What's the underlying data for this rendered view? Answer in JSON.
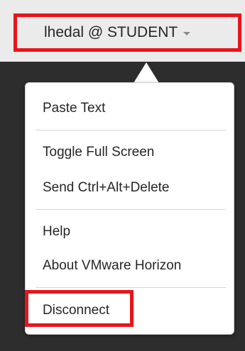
{
  "header": {
    "user_label": "lhedal @ STUDENT",
    "dropdown_icon": "caret-down-icon"
  },
  "menu": {
    "paste_text": "Paste Text",
    "toggle_full_screen": "Toggle Full Screen",
    "send_ctrl_alt_delete": "Send Ctrl+Alt+Delete",
    "help": "Help",
    "about": "About VMware Horizon",
    "disconnect": "Disconnect"
  },
  "colors": {
    "highlight": "#e8141b",
    "background": "#2d2d2d",
    "top_bar": "#ebebeb",
    "menu_background": "#ffffff"
  }
}
